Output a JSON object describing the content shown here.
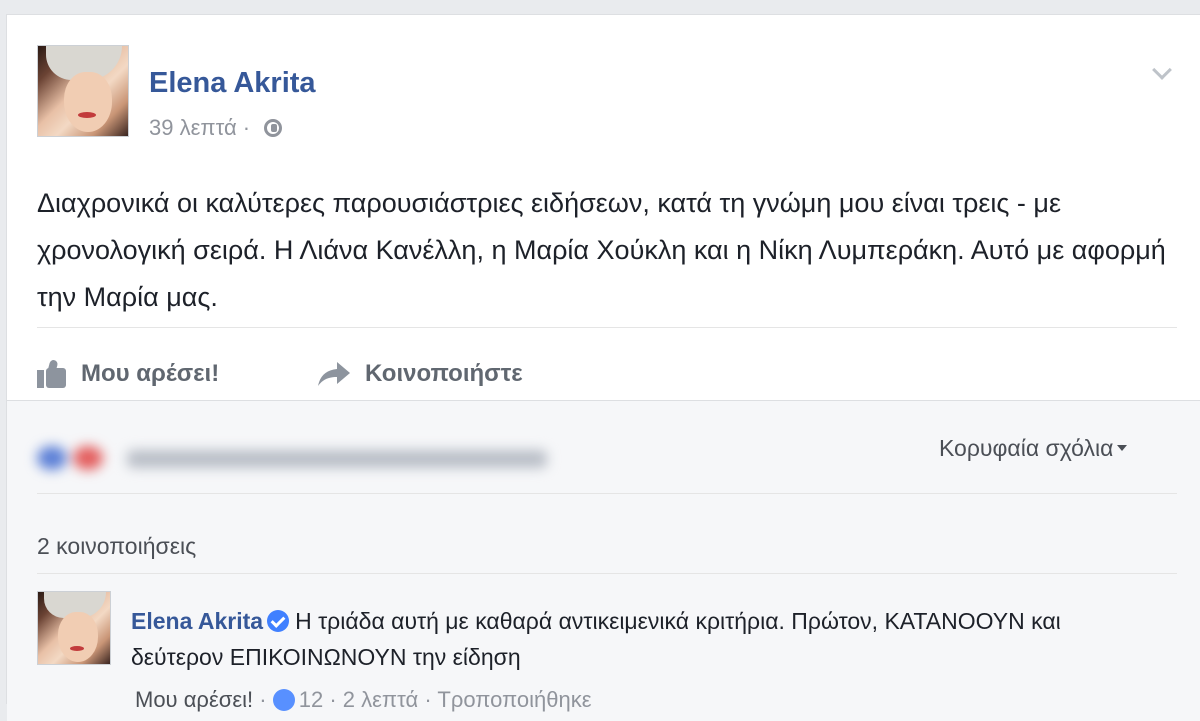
{
  "post": {
    "author": "Elena Akrita",
    "time": "39 λεπτά",
    "separator": "·",
    "text": "Διαχρονικά οι καλύτερες παρουσιάστριες ειδήσεων, κατά τη γνώμη μου είναι τρεις - με χρονολογική σειρά. Η Λιάνα Κανέλλη, η Μαρία Χούκλη και η Νίκη Λυμπεράκη. Αυτό με αφορμή την Μαρία μας."
  },
  "actions": {
    "like_label": "Μου αρέσει!",
    "share_label": "Κοινοποιήστε"
  },
  "comments": {
    "sort_label": "Κορυφαία σχόλια",
    "shares_label": "2 κοινοποιήσεις",
    "items": [
      {
        "author": "Elena Akrita",
        "text": "Η τριάδα αυτή με καθαρά αντικειμενικά κριτήρια. Πρώτον, ΚΑΤΑΝΟΟΥΝ και δεύτερον ΕΠΙΚΟΙΝΩΝΟΥΝ την είδηση",
        "like_link": "Μου αρέσει!",
        "reaction_count": "12",
        "time": "2 λεπτά",
        "edited": "Τροποποιήθηκε"
      }
    ]
  },
  "colors": {
    "link": "#365899",
    "meta": "#90949c",
    "text": "#1d2129"
  },
  "icons": [
    "globe-icon",
    "chevron-down-icon",
    "like-icon",
    "share-icon",
    "verified-badge-icon",
    "like-reaction-icon"
  ]
}
